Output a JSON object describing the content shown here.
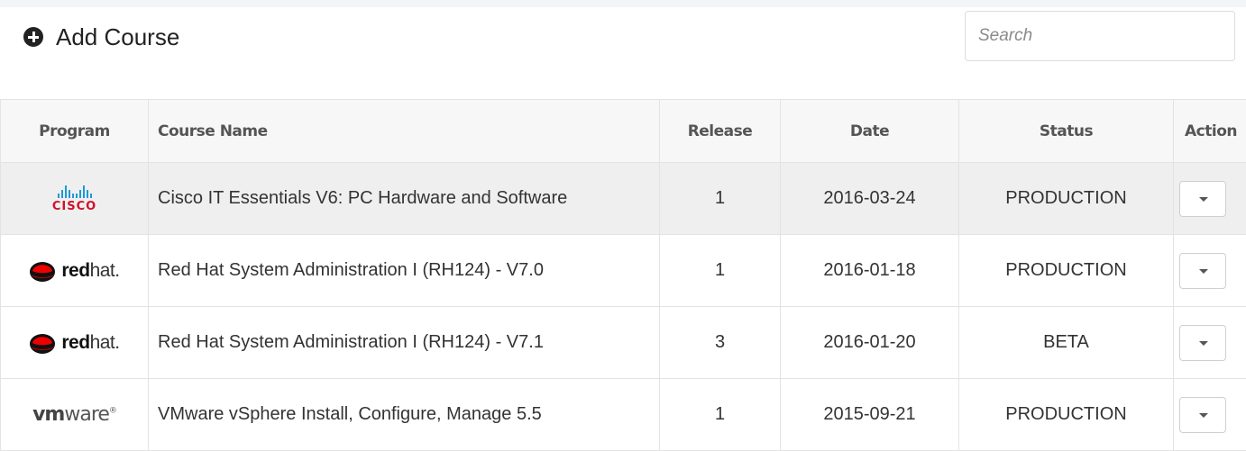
{
  "header": {
    "add_course_label": "Add Course",
    "search_placeholder": "Search"
  },
  "table": {
    "columns": [
      "Program",
      "Course Name",
      "Release",
      "Date",
      "Status",
      "Action"
    ],
    "rows": [
      {
        "program": "cisco",
        "program_text": "CISCO",
        "course": "Cisco IT Essentials V6: PC Hardware and Software",
        "release": "1",
        "date": "2016-03-24",
        "status": "PRODUCTION"
      },
      {
        "program": "redhat",
        "program_text": "redhat",
        "course": "Red Hat System Administration I (RH124) - V7.0",
        "release": "1",
        "date": "2016-01-18",
        "status": "PRODUCTION"
      },
      {
        "program": "redhat",
        "program_text": "redhat",
        "course": "Red Hat System Administration I (RH124) - V7.1",
        "release": "3",
        "date": "2016-01-20",
        "status": "BETA"
      },
      {
        "program": "vmware",
        "program_text": "vmware",
        "course": "VMware vSphere Install, Configure, Manage 5.5",
        "release": "1",
        "date": "2015-09-21",
        "status": "PRODUCTION"
      }
    ]
  },
  "logos": {
    "cisco": {
      "word": "CISCO",
      "bar_color": "#1d9ad6",
      "text_color": "#d0112b"
    },
    "redhat": {
      "bold": "red",
      "thin": "hat",
      "trademark": "."
    },
    "vmware": {
      "bold": "vm",
      "thin": "ware",
      "mark": "®"
    }
  },
  "colors": {
    "highlight_row": "#efefef",
    "header_bg": "#f7f7f7",
    "border": "#e3e3e3"
  }
}
